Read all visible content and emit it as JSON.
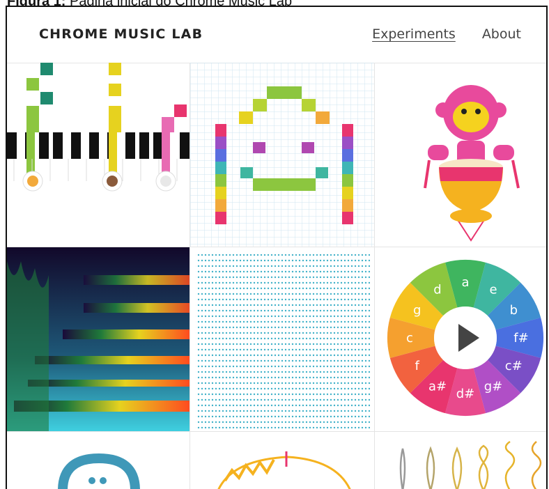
{
  "caption": {
    "label": "Figura 1:",
    "text": " Página inicial do Chrome Music Lab"
  },
  "header": {
    "brand": "CHROME MUSIC LAB",
    "nav": [
      {
        "label": "Experiments"
      },
      {
        "label": "About"
      }
    ]
  },
  "chord_wheel": {
    "notes": [
      "a",
      "e",
      "b",
      "f#",
      "c#",
      "g#",
      "d#",
      "a#",
      "f",
      "c",
      "g",
      "d"
    ]
  },
  "colors": {
    "accent_green": "#8cc63f",
    "brand_text": "#222222"
  }
}
